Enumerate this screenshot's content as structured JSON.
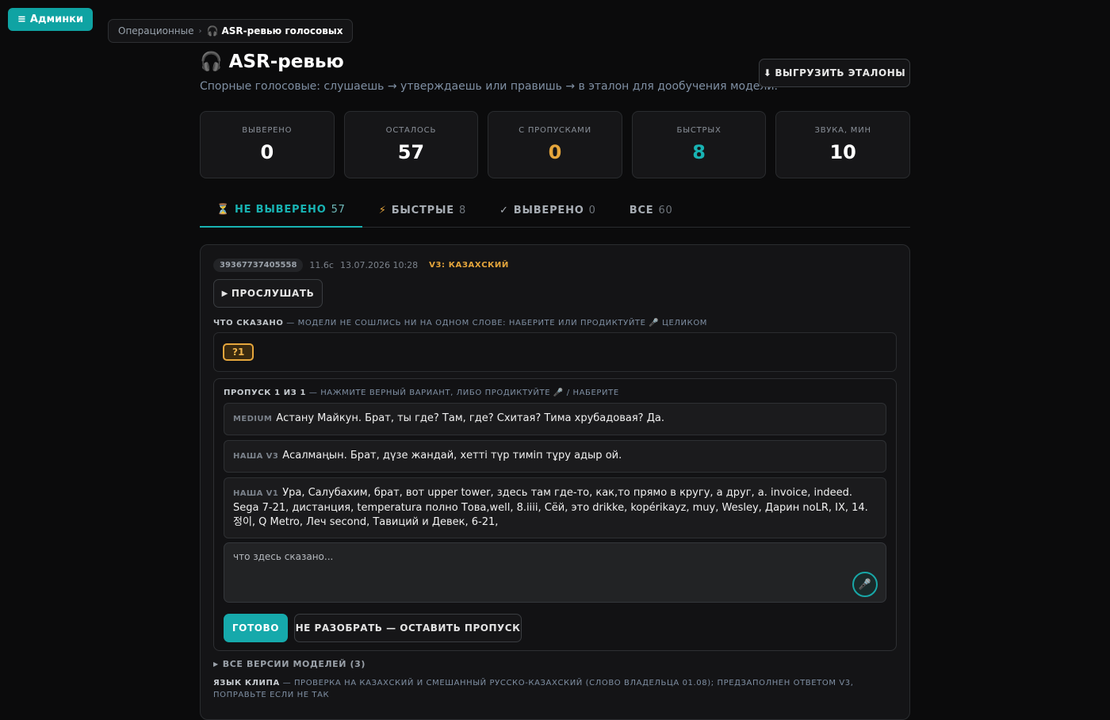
{
  "admin_button": {
    "icon": "≡",
    "label": "Админки"
  },
  "breadcrumb": {
    "parent": "Операционные",
    "separator": "›",
    "current_icon": "🎧",
    "current": "ASR-ревью голосовых"
  },
  "header": {
    "title_icon": "🎧",
    "title": "ASR-ревью",
    "subtitle": "Спорные голосовые: слушаешь → утверждаешь или правишь → в эталон для дообучения модели.",
    "export_icon": "⬇",
    "export_label": "ВЫГРУЗИТЬ ЭТАЛОНЫ"
  },
  "stats": [
    {
      "label": "ВЫВЕРЕНО",
      "value": "0",
      "color": "#ffffff"
    },
    {
      "label": "ОСТАЛОСЬ",
      "value": "57",
      "color": "#ffffff"
    },
    {
      "label": "С ПРОПУСКАМИ",
      "value": "0",
      "color": "#e6a63c"
    },
    {
      "label": "БЫСТРЫХ",
      "value": "8",
      "color": "#18b3b3"
    },
    {
      "label": "ЗВУКА, МИН",
      "value": "10",
      "color": "#ffffff"
    }
  ],
  "tabs": [
    {
      "icon": "⏳",
      "label": "НЕ ВЫВЕРЕНО",
      "count": "57",
      "active": true
    },
    {
      "icon": "⚡",
      "label": "БЫСТРЫЕ",
      "count": "8",
      "active": false
    },
    {
      "icon": "✓",
      "label": "ВЫВЕРЕНО",
      "count": "0",
      "active": false
    },
    {
      "icon": "",
      "label": "ВСЕ",
      "count": "60",
      "active": false
    }
  ],
  "card": {
    "clip_id": "39367737405558",
    "duration": "11.6с",
    "datetime": "13.07.2026 10:28",
    "language_tag": "V3: КАЗАХСКИЙ",
    "listen_icon": "▶",
    "listen_label": "ПРОСЛУШАТЬ",
    "said_title": "ЧТО СКАЗАНО",
    "said_hint": "— МОДЕЛИ НЕ СОШЛИСЬ НИ НА ОДНОМ СЛОВЕ: НАБЕРИТЕ ИЛИ ПРОДИКТУЙТЕ 🎤 ЦЕЛИКОМ",
    "gap_chip": "?1",
    "gap_title": "ПРОПУСК 1 ИЗ 1",
    "gap_hint": "— НАЖМИТЕ ВЕРНЫЙ ВАРИАНТ, ЛИБО ПРОДИКТУЙТЕ 🎤 / НАБЕРИТЕ",
    "variants": [
      {
        "tag": "MEDIUM",
        "text": "Астану Майкун. Брат, ты где? Там, где? Схитая? Тима хрубадовая? Да."
      },
      {
        "tag": "НАША V3",
        "text": "Асалмаңын. Брат, дүзе жандай, хетті түр тиміп тұру адыр ой."
      },
      {
        "tag": "НАША V1",
        "text": "Ура, Салубахим, брат, вот upper tower, здесь там где-то, как,то прямо в кругу, а друг, а. invoice, indeed. Sega 7-21, дистанция, temperatura полно Това,well, 8.iiii, Сёй, это drikke, kopérikayz, muy, Wesley, Дарин noLR, IX, 14.정이, Q Metro, Леч second, Тавиций и Девек, 6-21,"
      }
    ],
    "answer_placeholder": "что здесь сказано...",
    "mic_icon": "🎤",
    "done_label": "ГОТОВО",
    "skip_label": "НЕ РАЗОБРАТЬ — ОСТАВИТЬ ПРОПУСК",
    "versions_caret": "▶",
    "versions_label": "ВСЕ ВЕРСИИ МОДЕЛЕЙ (3)",
    "lang_title": "ЯЗЫК КЛИПА",
    "lang_hint": "— ПРОВЕРКА НА КАЗАХСКИЙ И СМЕШАННЫЙ РУССКО-КАЗАХСКИЙ (СЛОВО ВЛАДЕЛЬЦА 01.08); ПРЕДЗАПОЛНЕН ОТВЕТОМ V3, ПОПРАВЬТЕ ЕСЛИ НЕ ТАК"
  }
}
